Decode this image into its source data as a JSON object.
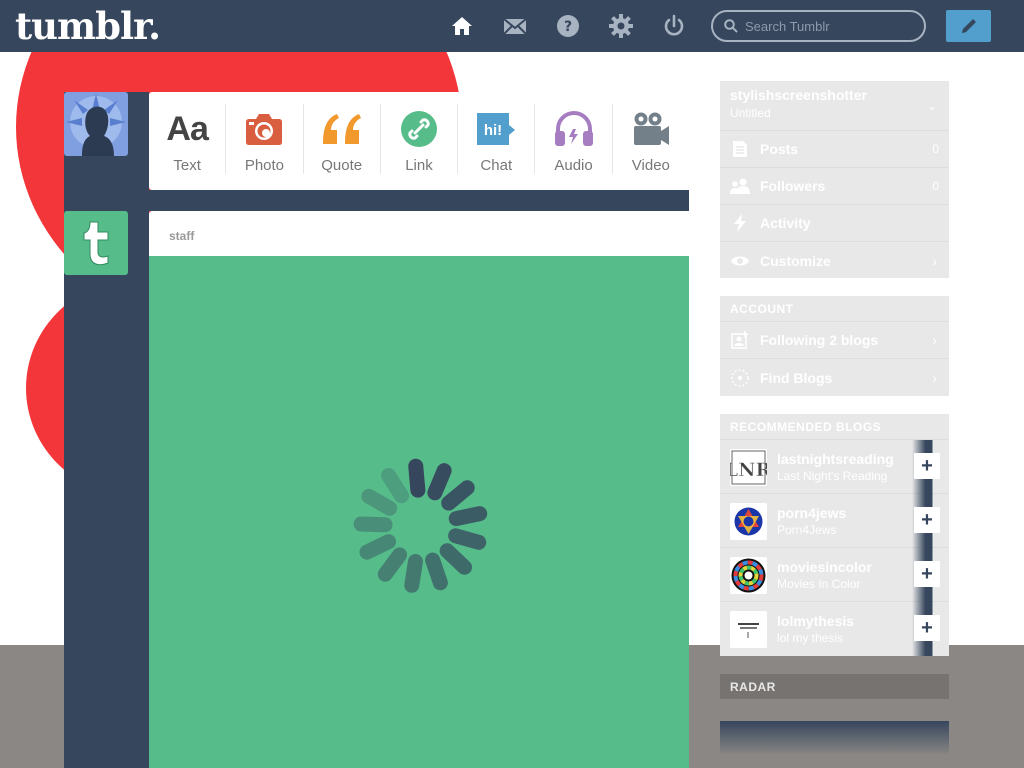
{
  "header": {
    "logo": "tumblr.",
    "nav_icons": [
      "home-icon",
      "mail-icon",
      "help-icon",
      "gear-icon",
      "power-icon"
    ],
    "search_placeholder": "Search Tumblr",
    "compose_icon": "pencil-icon"
  },
  "post_types": [
    {
      "label": "Text",
      "icon": "text-icon",
      "color": "#444444"
    },
    {
      "label": "Photo",
      "icon": "camera-icon",
      "color": "#d95e40"
    },
    {
      "label": "Quote",
      "icon": "quote-icon",
      "color": "#f2992e"
    },
    {
      "label": "Link",
      "icon": "link-icon",
      "color": "#56bc8a"
    },
    {
      "label": "Chat",
      "icon": "chat-icon",
      "color": "#529ecc",
      "glyph": "hi!"
    },
    {
      "label": "Audio",
      "icon": "headphones-icon",
      "color": "#a77dc2"
    },
    {
      "label": "Video",
      "icon": "video-camera-icon",
      "color": "#748089"
    }
  ],
  "post": {
    "author": "staff",
    "body_color": "#56bc8a"
  },
  "sidebar": {
    "blog": {
      "name": "stylishscreenshotter",
      "subtitle": "Untitled",
      "items": [
        {
          "label": "Posts",
          "icon": "posts-icon",
          "count": "0"
        },
        {
          "label": "Followers",
          "icon": "followers-icon",
          "count": "0"
        },
        {
          "label": "Activity",
          "icon": "lightning-icon",
          "count": ""
        },
        {
          "label": "Customize",
          "icon": "eye-icon",
          "count": ""
        }
      ]
    },
    "account": {
      "title": "ACCOUNT",
      "items": [
        {
          "label": "Following 2 blogs",
          "icon": "following-icon"
        },
        {
          "label": "Find Blogs",
          "icon": "find-blogs-icon"
        }
      ]
    },
    "recommended": {
      "title": "RECOMMENDED BLOGS",
      "blogs": [
        {
          "name": "lastnightsreading",
          "title": "Last Night's Reading"
        },
        {
          "name": "porn4jews",
          "title": "Porn4Jews"
        },
        {
          "name": "moviesincolor",
          "title": "Movies In Color"
        },
        {
          "name": "lolmythesis",
          "title": "lol my thesis"
        }
      ]
    },
    "radar": {
      "title": "RADAR"
    }
  },
  "colors": {
    "navy": "#36465d",
    "accent_blue": "#529ecc",
    "brand_red": "#f2363a",
    "green": "#56bc8a"
  }
}
